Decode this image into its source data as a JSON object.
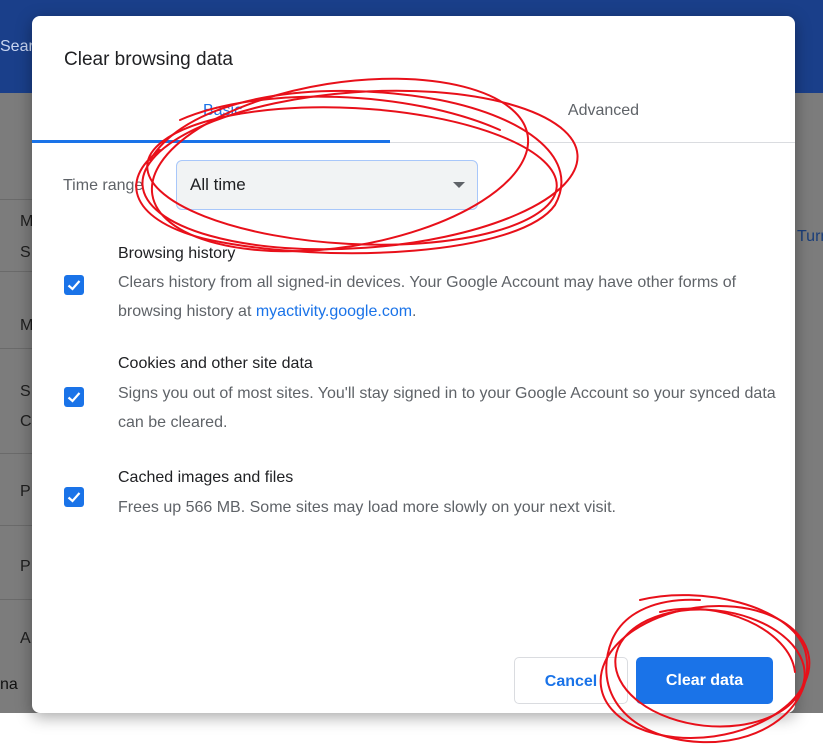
{
  "background": {
    "header_text": "Search",
    "left_letters": [
      "M",
      "S",
      "M",
      "S",
      "C",
      "P",
      "P",
      "A"
    ],
    "right_text": "Turn",
    "bottom_text": "na"
  },
  "dialog": {
    "title": "Clear browsing data",
    "tabs": [
      {
        "label": "Basic",
        "selected": true
      },
      {
        "label": "Advanced",
        "selected": false
      }
    ],
    "time_range": {
      "label": "Time range",
      "value": "All time"
    },
    "items": [
      {
        "title": "Browsing history",
        "desc_before": "Clears history from all signed-in devices. Your Google Account may have other forms of browsing history at ",
        "desc_link": "myactivity.google.com",
        "desc_after": ".",
        "checked": true
      },
      {
        "title": "Cookies and other site data",
        "desc": "Signs you out of most sites. You'll stay signed in to your Google Account so your synced data can be cleared.",
        "checked": true
      },
      {
        "title": "Cached images and files",
        "desc": "Frees up 566 MB. Some sites may load more slowly on your next visit.",
        "checked": true
      }
    ],
    "buttons": {
      "cancel": "Cancel",
      "clear": "Clear data"
    }
  },
  "colors": {
    "accent": "#1a73e8",
    "annotation": "#e8101a",
    "header": "#1a3f8a"
  }
}
